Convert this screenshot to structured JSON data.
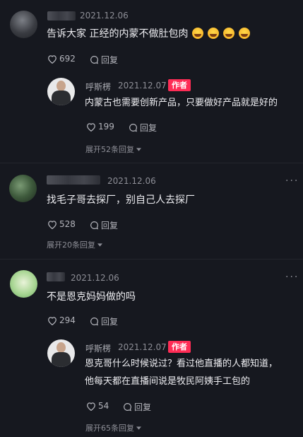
{
  "comments": [
    {
      "date": "2021.12.06",
      "text": "告诉大家 正经的内蒙不做肚包肉",
      "likes": "692",
      "reply_label": "回复",
      "more": "···"
    },
    {
      "name": "呼斯楞",
      "date": "2021.12.07",
      "badge": "作者",
      "text": "内蒙古也需要创新产品，只要做好产品就是好的",
      "likes": "199",
      "reply_label": "回复",
      "expand": "展开52条回复"
    },
    {
      "date": "2021.12.06",
      "text": "找毛子哥去探厂，别自己人去探厂",
      "likes": "528",
      "reply_label": "回复",
      "expand": "展开20条回复",
      "more": "···"
    },
    {
      "date": "2021.12.06",
      "text": "不是恩克妈妈做的吗",
      "likes": "294",
      "reply_label": "回复",
      "more": "···"
    },
    {
      "name": "呼斯楞",
      "date": "2021.12.07",
      "badge": "作者",
      "text_line1": "恩克哥什么时候说过？看过他直播的人都知道，",
      "text_line2": "他每天都在直播间说是牧民阿姨手工包的",
      "likes": "54",
      "reply_label": "回复",
      "expand": "展开65条回复"
    }
  ]
}
